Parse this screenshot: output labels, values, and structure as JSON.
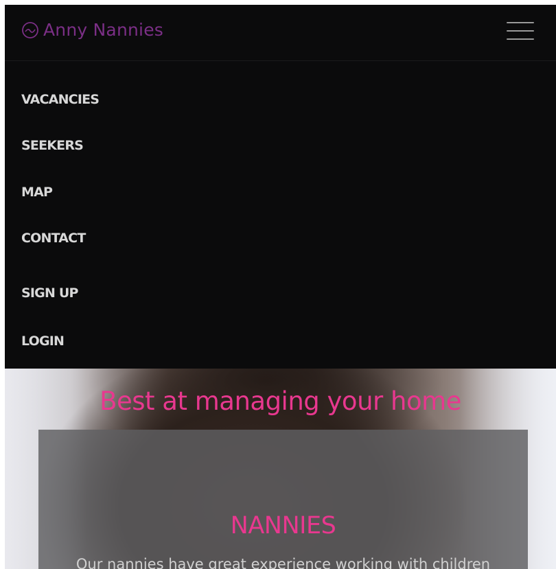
{
  "brand": {
    "name": "Anny Nannies",
    "icon": "circle-logo-icon",
    "color": "#7b2f86"
  },
  "navbar": {
    "menu_icon": "hamburger-menu-icon"
  },
  "menu": {
    "items": [
      {
        "label": "VACANCIES"
      },
      {
        "label": "SEEKERS"
      },
      {
        "label": "MAP"
      },
      {
        "label": "CONTACT"
      },
      {
        "label": "SIGN UP"
      },
      {
        "label": "LOGIN"
      }
    ]
  },
  "hero": {
    "title": "Best at managing your home",
    "accent_color": "#e8388f"
  },
  "panel": {
    "title": "NANNIES",
    "text": "Our nannies have great experience working with children"
  }
}
